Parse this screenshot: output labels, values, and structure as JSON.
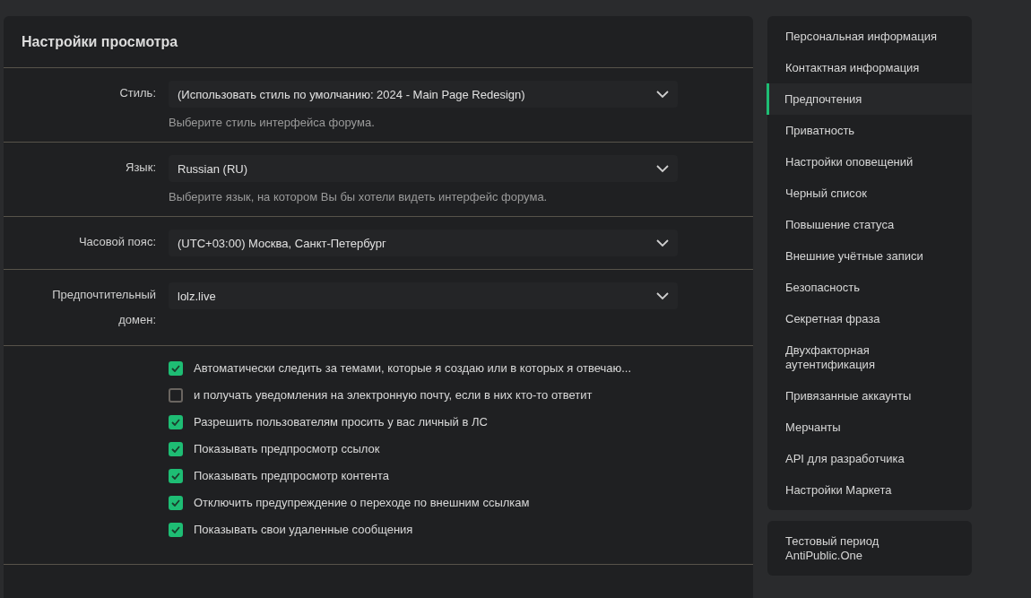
{
  "panel": {
    "title": "Настройки просмотра"
  },
  "fields": [
    {
      "label": "Стиль:",
      "value": "(Использовать стиль по умолчанию: 2024 - Main Page Redesign)",
      "hint": "Выберите стиль интерфейса форума."
    },
    {
      "label": "Язык:",
      "value": "Russian (RU)",
      "hint": "Выберите язык, на котором Вы бы хотели видеть интерфейс форума."
    },
    {
      "label": "Часовой пояс:",
      "value": "(UTC+03:00) Москва, Санкт-Петербург"
    },
    {
      "label": "Предпочтительный домен:",
      "value": "lolz.live"
    }
  ],
  "options": [
    {
      "label": "Автоматически следить за темами, которые я создаю или в которых я отвечаю...",
      "checked": true
    },
    {
      "label": "и получать уведомления на электронную почту, если в них кто-то ответит",
      "checked": false
    },
    {
      "label": "Разрешить пользователям просить у вас личный в ЛС",
      "checked": true
    },
    {
      "label": "Показывать предпросмотр ссылок",
      "checked": true
    },
    {
      "label": "Показывать предпросмотр контента",
      "checked": true
    },
    {
      "label": "Отключить предупреждение о переходе по внешним ссылкам",
      "checked": true
    },
    {
      "label": "Показывать свои удаленные сообщения",
      "checked": true
    }
  ],
  "sidebar": {
    "items": [
      {
        "label": "Персональная информация",
        "selected": false
      },
      {
        "label": "Контактная информация",
        "selected": false
      },
      {
        "label": "Предпочтения",
        "selected": true
      },
      {
        "label": "Приватность",
        "selected": false
      },
      {
        "label": "Настройки оповещений",
        "selected": false
      },
      {
        "label": "Черный список",
        "selected": false
      },
      {
        "label": "Повышение статуса",
        "selected": false
      },
      {
        "label": "Внешние учётные записи",
        "selected": false
      },
      {
        "label": "Безопасность",
        "selected": false
      },
      {
        "label": "Секретная фраза",
        "selected": false
      },
      {
        "label": "Двухфакторная аутентификация",
        "selected": false
      },
      {
        "label": "Привязанные аккаунты",
        "selected": false
      },
      {
        "label": "Мерчанты",
        "selected": false
      },
      {
        "label": "API для разработчика",
        "selected": false
      },
      {
        "label": "Настройки Маркета",
        "selected": false
      }
    ],
    "extra": [
      {
        "label": "Тестовый период AntiPublic.One",
        "selected": false
      }
    ]
  }
}
